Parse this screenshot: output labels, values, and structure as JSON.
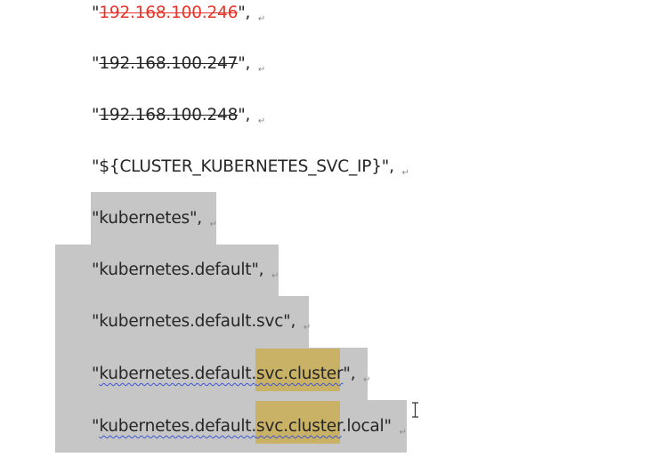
{
  "lines": [
    {
      "q1": "\"",
      "text": "192.168.100.246",
      "q2": "\", ",
      "mark": "↵"
    },
    {
      "q1": "\"",
      "text": "192.168.100.247",
      "q2": "\", ",
      "mark": "↵"
    },
    {
      "q1": "\"",
      "text": "192.168.100.248",
      "q2": "\", ",
      "mark": "↵"
    },
    {
      "text": "\"${CLUSTER_KUBERNETES_SVC_IP}\", ",
      "mark": "↵"
    },
    {
      "text": "\"kubernetes\", ",
      "mark": "↵"
    },
    {
      "text": "\"kubernetes.default\", ",
      "mark": "↵"
    },
    {
      "text": "\"kubernetes.default.svc\", ",
      "mark": "↵"
    },
    {
      "q1": "\"",
      "a": "kubernetes.default.",
      "b": "svc.cluster",
      "q2": "\", ",
      "mark": "↵"
    },
    {
      "q1": "\"",
      "a": "kubernetes.default.",
      "b": "svc.cluster",
      "c": ".local",
      "q2": "\" ",
      "mark": "↵"
    }
  ],
  "colors": {
    "selection": "#c6c6c6",
    "highlight": "#c9b265",
    "deleted_text": "#e8342a",
    "spell_underline": "#3b55d4"
  },
  "icons": {
    "text_cursor": "i-beam-cursor-icon"
  }
}
